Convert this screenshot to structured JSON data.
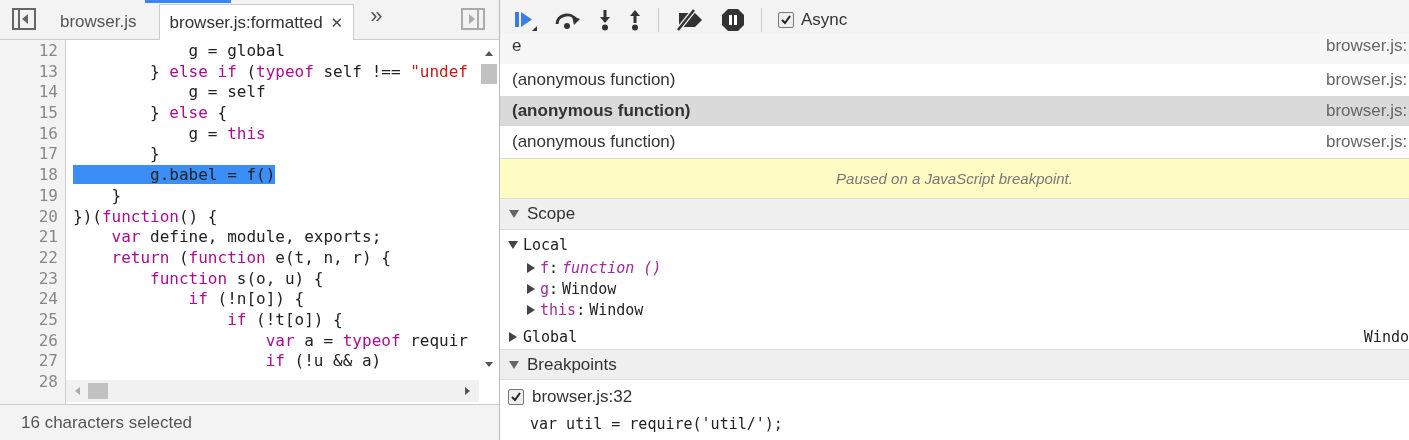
{
  "editor_tabs": [
    {
      "label": "browser.js",
      "selected": false
    },
    {
      "label": "browser.js:formatted",
      "selected": true,
      "close": "✕"
    }
  ],
  "more_tabs": "»",
  "code_lines": [
    {
      "number": "12",
      "tokens": [
        {
          "kind": "plain",
          "text": "            g = global"
        }
      ]
    },
    {
      "number": "13",
      "tokens": [
        {
          "kind": "plain",
          "text": "        } "
        },
        {
          "kind": "keyword",
          "text": "else if"
        },
        {
          "kind": "plain",
          "text": " ("
        },
        {
          "kind": "keyword",
          "text": "typeof"
        },
        {
          "kind": "plain",
          "text": " self !== "
        },
        {
          "kind": "string",
          "text": "\"undef"
        }
      ]
    },
    {
      "number": "14",
      "tokens": [
        {
          "kind": "plain",
          "text": "            g = self"
        }
      ]
    },
    {
      "number": "15",
      "tokens": [
        {
          "kind": "plain",
          "text": "        } "
        },
        {
          "kind": "keyword",
          "text": "else"
        },
        {
          "kind": "plain",
          "text": " {"
        }
      ]
    },
    {
      "number": "16",
      "tokens": [
        {
          "kind": "plain",
          "text": "            g = "
        },
        {
          "kind": "keyword",
          "text": "this"
        }
      ]
    },
    {
      "number": "17",
      "tokens": [
        {
          "kind": "plain",
          "text": "        }"
        }
      ]
    },
    {
      "number": "18",
      "tokens": [
        {
          "kind": "selected",
          "text": "        g.babel = f()"
        }
      ]
    },
    {
      "number": "19",
      "tokens": [
        {
          "kind": "plain",
          "text": "    }"
        }
      ]
    },
    {
      "number": "20",
      "tokens": [
        {
          "kind": "plain",
          "text": "})("
        },
        {
          "kind": "keyword",
          "text": "function"
        },
        {
          "kind": "plain",
          "text": "() {"
        }
      ]
    },
    {
      "number": "21",
      "tokens": [
        {
          "kind": "keyword",
          "text": "    var"
        },
        {
          "kind": "plain",
          "text": " define, module, exports;"
        }
      ]
    },
    {
      "number": "22",
      "tokens": [
        {
          "kind": "keyword",
          "text": "    return"
        },
        {
          "kind": "plain",
          "text": " ("
        },
        {
          "kind": "keyword",
          "text": "function"
        },
        {
          "kind": "plain",
          "text": " e(t, n, r) {"
        }
      ]
    },
    {
      "number": "23",
      "tokens": [
        {
          "kind": "keyword",
          "text": "        function"
        },
        {
          "kind": "plain",
          "text": " s(o, u) {"
        }
      ]
    },
    {
      "number": "24",
      "tokens": [
        {
          "kind": "keyword",
          "text": "            if"
        },
        {
          "kind": "plain",
          "text": " (!n[o]) {"
        }
      ]
    },
    {
      "number": "25",
      "tokens": [
        {
          "kind": "keyword",
          "text": "                if"
        },
        {
          "kind": "plain",
          "text": " (!t[o]) {"
        }
      ]
    },
    {
      "number": "26",
      "tokens": [
        {
          "kind": "keyword",
          "text": "                    var"
        },
        {
          "kind": "plain",
          "text": " a = "
        },
        {
          "kind": "keyword",
          "text": "typeof"
        },
        {
          "kind": "plain",
          "text": " requir"
        }
      ]
    },
    {
      "number": "27",
      "tokens": [
        {
          "kind": "keyword",
          "text": "                    if"
        },
        {
          "kind": "plain",
          "text": " (!u && a)"
        }
      ]
    },
    {
      "number": "28"
    }
  ],
  "status_bar": "16 characters selected",
  "debugger_toolbar": {
    "async": {
      "label": "Async",
      "checked": true
    }
  },
  "call_stack": [
    {
      "name": "e",
      "location": "browser.js:",
      "selected": false,
      "partial": true
    },
    {
      "name": "(anonymous function)",
      "location": "browser.js:",
      "selected": false,
      "partial": false
    },
    {
      "name": "(anonymous function)",
      "location": "browser.js:",
      "selected": true,
      "partial": false
    },
    {
      "name": "(anonymous function)",
      "location": "browser.js:",
      "selected": false,
      "partial": false
    }
  ],
  "paused_message": "Paused on a JavaScript breakpoint.",
  "scope": {
    "title": "Scope",
    "expanded": true,
    "sections": [
      {
        "name": "Local",
        "expanded": true,
        "children": [
          {
            "name": "f",
            "separator": ":",
            "value": "function ()",
            "kind": "function",
            "expanded": false
          },
          {
            "name": "g",
            "separator": ":",
            "value": "Window",
            "kind": "object",
            "expanded": false
          },
          {
            "name": "this",
            "separator": ":",
            "value": "Window",
            "kind": "object",
            "expanded": false
          }
        ]
      },
      {
        "name": "Global",
        "expanded": false,
        "value": "Windo"
      }
    ]
  },
  "breakpoints": {
    "title": "Breakpoints",
    "expanded": true,
    "items": [
      {
        "label": "browser.js:32",
        "checked": true,
        "code": "var util = require('util/');"
      }
    ]
  }
}
